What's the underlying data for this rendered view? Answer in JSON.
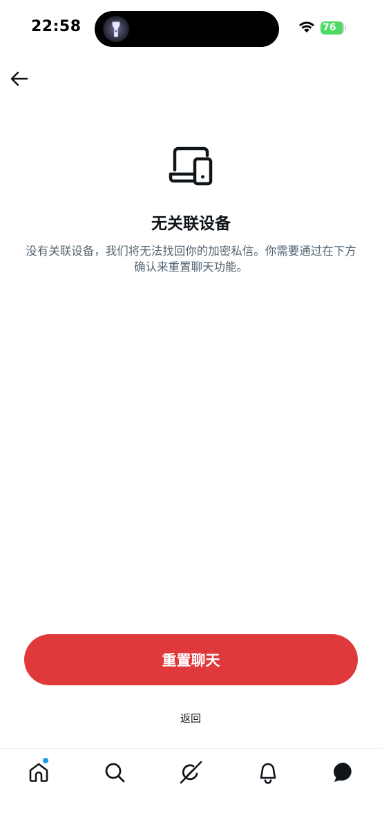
{
  "status_bar": {
    "time": "22:58",
    "battery": "76"
  },
  "header": {
    "back_icon": "arrow-left-icon"
  },
  "content": {
    "icon": "laptop-phone-icon",
    "title": "无关联设备",
    "description": "没有关联设备，我们将无法找回你的加密私信。你需要通过在下方确认来重置聊天功能。"
  },
  "actions": {
    "reset_label": "重置聊天",
    "return_label": "返回"
  },
  "colors": {
    "accent_red": "#e0393b",
    "notification_dot": "#1d9bf0",
    "secondary_text": "#536471"
  },
  "bottom_nav": {
    "items": [
      {
        "icon": "home-icon",
        "has_notification": true
      },
      {
        "icon": "search-icon"
      },
      {
        "icon": "grok-icon"
      },
      {
        "icon": "bell-icon"
      },
      {
        "icon": "chat-icon"
      }
    ]
  }
}
